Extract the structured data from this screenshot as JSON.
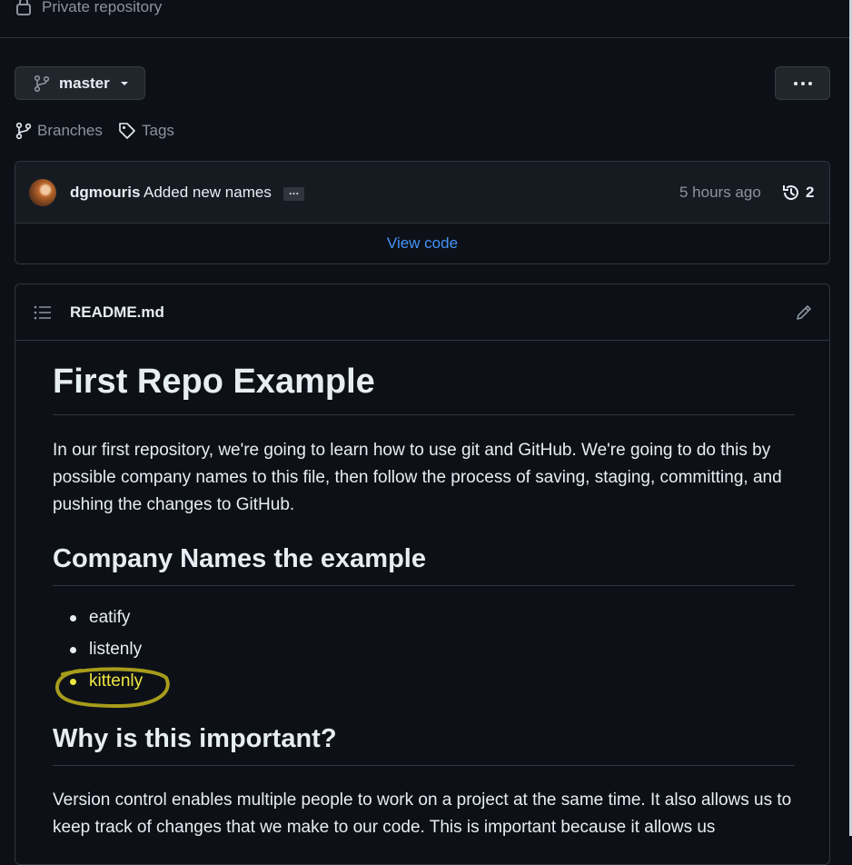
{
  "repo": {
    "visibility_label": "Private repository"
  },
  "branch_selector": {
    "branch": "master"
  },
  "refs": {
    "branches_label": "Branches",
    "tags_label": "Tags"
  },
  "latest_commit": {
    "author": "dgmouris",
    "message": "Added new names",
    "ellipsis": "…",
    "time": "5 hours ago",
    "history_count": "2",
    "view_code_label": "View code"
  },
  "readme": {
    "filename": "README.md",
    "title": "First Repo Example",
    "intro": "In our first repository, we're going to learn how to use git and GitHub. We're going to do this by possible company names to this file, then follow the process of saving, staging, committing, and pushing the changes to GitHub.",
    "section1_heading": "Company Names the example",
    "company_names": [
      "eatify",
      "listenly",
      "kittenly"
    ],
    "section2_heading": "Why is this important?",
    "section2_text": "Version control enables multiple people to work on a project at the same time. It also allows us to keep track of changes that we make to our code. This is important because it allows us"
  },
  "colors": {
    "background": "#0d1117",
    "link": "#4493f8",
    "highlight": "#f0e640"
  }
}
